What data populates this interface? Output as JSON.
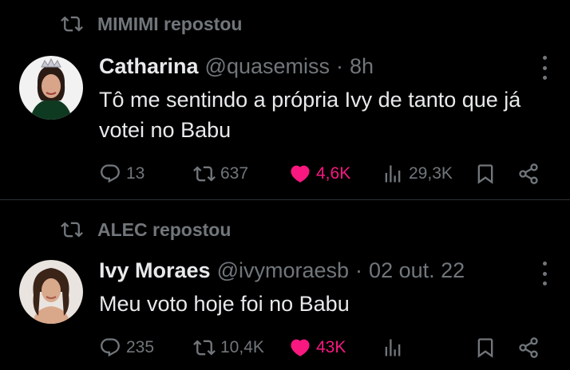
{
  "colors": {
    "background": "#000000",
    "text": "#e7e9ea",
    "muted": "#71767b",
    "like_active": "#f91880",
    "divider": "#2f3336"
  },
  "tweets": [
    {
      "repost_label": "MIMIMI repostou",
      "name": "Catharina",
      "handle": "@quasemiss",
      "separator": "·",
      "time": "8h",
      "text": "Tô me sentindo a própria Ivy de tanto que já votei no Babu",
      "stats": {
        "replies": "13",
        "reposts": "637",
        "likes": "4,6K",
        "views": "29,3K"
      },
      "liked": true,
      "icons": [
        "repost-icon",
        "more-icon",
        "reply-icon",
        "repost-icon",
        "heart-icon",
        "views-icon",
        "bookmark-icon",
        "share-icon"
      ]
    },
    {
      "repost_label": "ALEC repostou",
      "name": "Ivy Moraes",
      "handle": "@ivymoraesb",
      "separator": "·",
      "time": "02 out. 22",
      "text": "Meu voto hoje foi no Babu",
      "stats": {
        "replies": "235",
        "reposts": "10,4K",
        "likes": "43K",
        "views": ""
      },
      "liked": true,
      "icons": [
        "repost-icon",
        "more-icon",
        "reply-icon",
        "repost-icon",
        "heart-icon",
        "views-icon",
        "bookmark-icon",
        "share-icon"
      ]
    }
  ]
}
